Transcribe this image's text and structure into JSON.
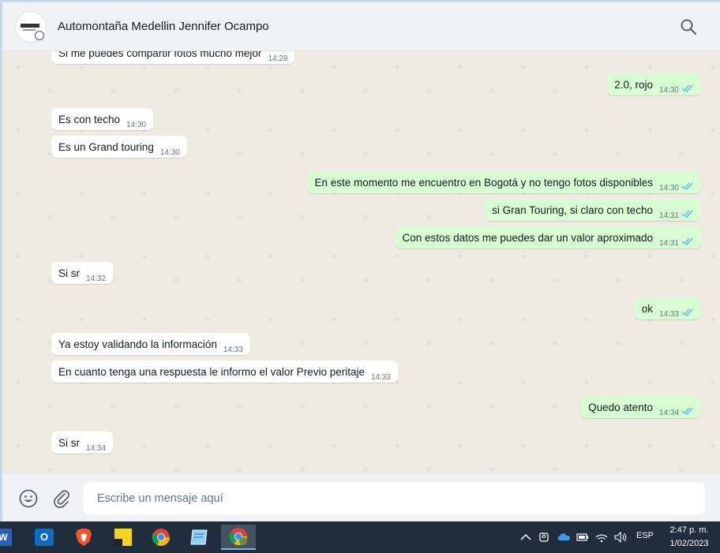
{
  "header": {
    "contact_name": "Automontaña Medellin Jennifer Ocampo"
  },
  "messages": [
    {
      "dir": "in",
      "text": "Si me puedes compartir fotos mucho mejor",
      "time": "14:28"
    },
    {
      "dir": "out",
      "text": "2.0, rojo",
      "time": "14:30",
      "status": "read"
    },
    {
      "dir": "in",
      "text": "Es con techo",
      "time": "14:30"
    },
    {
      "dir": "in",
      "text": "Es un Grand touring",
      "time": "14:30"
    },
    {
      "dir": "out",
      "text": "En este momento me encuentro en Bogotá y no tengo fotos disponibles",
      "time": "14:30",
      "status": "read"
    },
    {
      "dir": "out",
      "text": "si Gran Touring, si claro con techo",
      "time": "14:31",
      "status": "read"
    },
    {
      "dir": "out",
      "text": "Con estos datos me puedes dar un valor aproximado",
      "time": "14:31",
      "status": "read"
    },
    {
      "dir": "in",
      "text": "Si sr",
      "time": "14:32"
    },
    {
      "dir": "out",
      "text": "ok",
      "time": "14:33",
      "status": "read"
    },
    {
      "dir": "in",
      "text": "Ya estoy validando la información",
      "time": "14:33"
    },
    {
      "dir": "in",
      "text": "En cuanto tenga una respuesta le informo el valor Previo peritaje",
      "time": "14:33"
    },
    {
      "dir": "out",
      "text": "Quedo atento",
      "time": "14:34",
      "status": "read"
    },
    {
      "dir": "in",
      "text": "Si sr",
      "time": "14:34"
    }
  ],
  "composer": {
    "placeholder": "Escribe un mensaje aquí"
  },
  "taskbar": {
    "language": "ESP",
    "time": "2:47 p. m.",
    "date": "1/02/2023"
  },
  "colors": {
    "incoming_bubble": "#ffffff",
    "outgoing_bubble": "#d9fdd3",
    "read_ticks": "#53bdeb",
    "chat_background": "#efeae2"
  }
}
